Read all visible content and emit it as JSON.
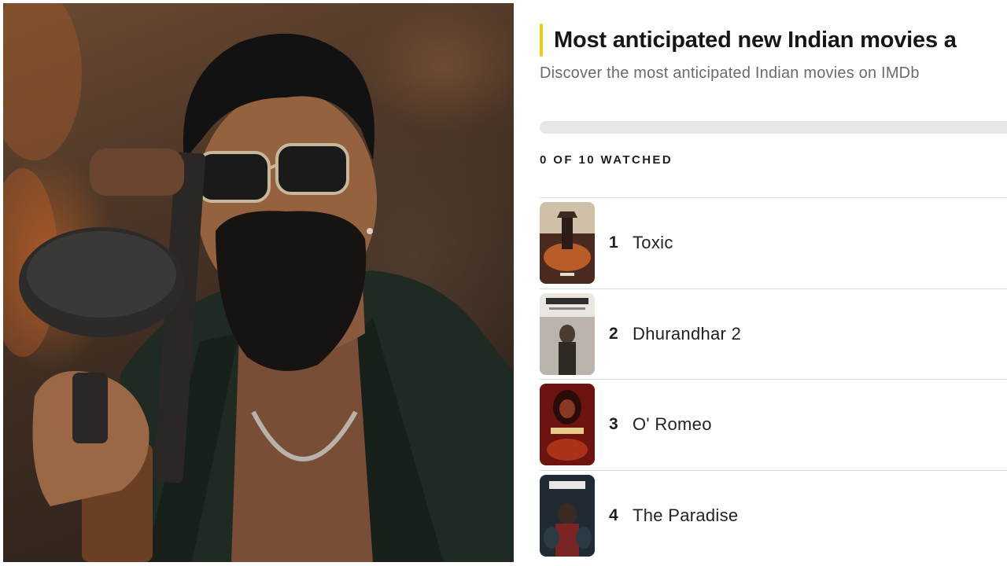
{
  "list": {
    "title": "Most anticipated new Indian movies a",
    "subtitle": "Discover the most anticipated Indian movies on IMDb",
    "progress_fraction": 0,
    "watched_label": "0 OF 10 WATCHED",
    "items": [
      {
        "rank": "1",
        "title": "Toxic"
      },
      {
        "rank": "2",
        "title": "Dhurandhar 2"
      },
      {
        "rank": "3",
        "title": "O' Romeo"
      },
      {
        "rank": "4",
        "title": "The Paradise"
      }
    ]
  },
  "colors": {
    "accent": "#f5c518",
    "progress_track": "#e6e6e6",
    "divider": "#dcdcdc"
  }
}
